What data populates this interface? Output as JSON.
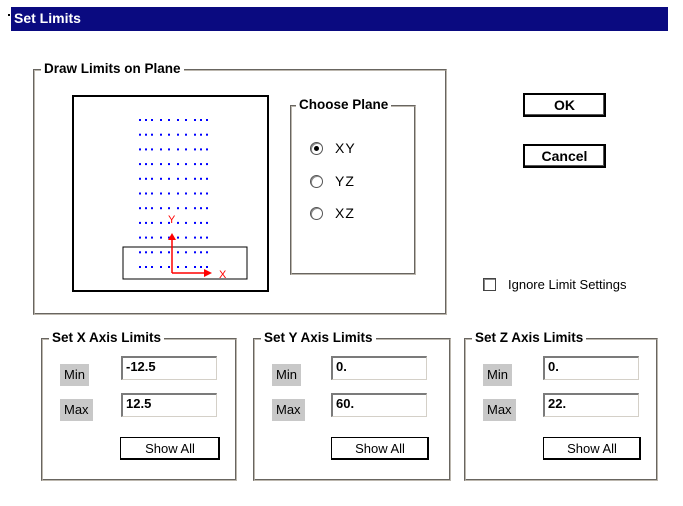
{
  "window": {
    "title": "Set Limits"
  },
  "draw_panel": {
    "legend": "Draw Limits on Plane",
    "x_axis_label": "X",
    "y_axis_label": "Y"
  },
  "choose_plane": {
    "legend": "Choose Plane",
    "options": [
      {
        "label": "XY",
        "selected": true
      },
      {
        "label": "YZ",
        "selected": false
      },
      {
        "label": "XZ",
        "selected": false
      }
    ]
  },
  "buttons": {
    "ok": "OK",
    "cancel": "Cancel"
  },
  "ignore_limit": {
    "label": "Ignore Limit Settings",
    "checked": false
  },
  "x_limits": {
    "legend": "Set X Axis Limits",
    "min_label": "Min",
    "max_label": "Max",
    "min": "-12.5",
    "max": "12.5",
    "show_all": "Show All"
  },
  "y_limits": {
    "legend": "Set Y Axis Limits",
    "min_label": "Min",
    "max_label": "Max",
    "min": "0.",
    "max": "60.",
    "show_all": "Show All"
  },
  "z_limits": {
    "legend": "Set Z Axis Limits",
    "min_label": "Min",
    "max_label": "Max",
    "min": "0.",
    "max": "22.",
    "show_all": "Show All"
  },
  "colors": {
    "titlebar": "#0a0a80",
    "grid_points": "#0000ff",
    "axis": "#ff0000",
    "label_bg": "#c8c8c8"
  }
}
